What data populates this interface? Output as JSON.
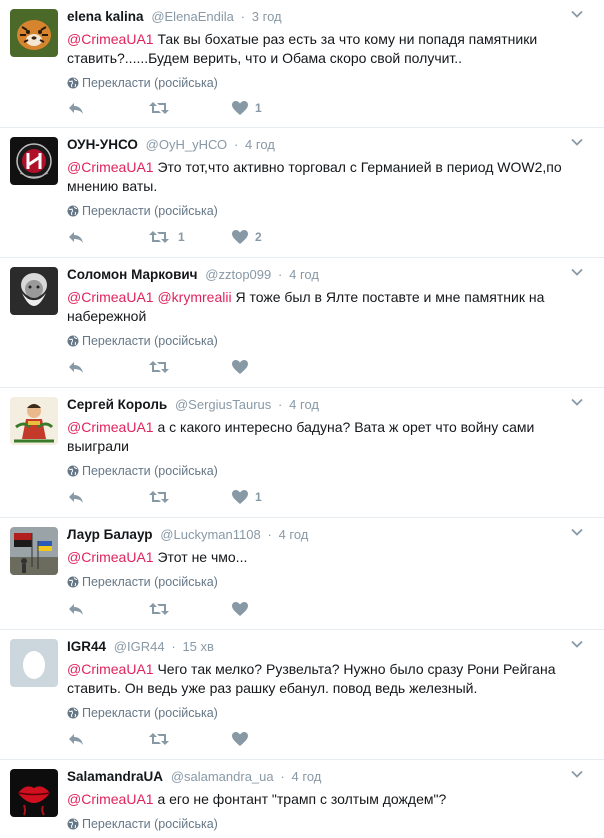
{
  "tweets": [
    {
      "name": "elena kalina",
      "handle": "@ElenaEndila",
      "time": "3 год",
      "mention": "@CrimeaUA1",
      "text": " Так вы бохатые раз есть за что кому ни попадя памятники ставить?......Будем верить, что и Обама скоро свой получит..",
      "translate": "Перекласти (російська)",
      "retweets": "",
      "likes": "1",
      "avatar": "tiger"
    },
    {
      "name": "ОУН-УНСО",
      "handle": "@ОуН_уНСО",
      "time": "4 год",
      "mention": "@CrimeaUA1",
      "text": " Это тот,что активно торговал с Германией  в период WOW2,по мнению ваты.",
      "translate": "Перекласти (російська)",
      "retweets": "1",
      "likes": "2",
      "avatar": "emblem"
    },
    {
      "name": "Соломон Маркович",
      "handle": "@zztop099",
      "time": "4 год",
      "mention": "@CrimeaUA1",
      "mention2": "@krymrealii",
      "text": " Я тоже был в Ялте поставте и мне памятник на набережной",
      "translate": "Перекласти (російська)",
      "retweets": "",
      "likes": "",
      "avatar": "bearded-man"
    },
    {
      "name": "Сергей Король",
      "handle": "@SergiusTaurus",
      "time": "4 год",
      "mention": "@CrimeaUA1",
      "text": " а с какого интересно бадуна? Вата ж орет что войну сами выиграли",
      "translate": "Перекласти (російська)",
      "retweets": "",
      "likes": "1",
      "avatar": "cossack"
    },
    {
      "name": "Лаур Балаур",
      "handle": "@Luckyman1108",
      "time": "4 год",
      "mention": "@CrimeaUA1",
      "text": " Этот не чмо...",
      "translate": "Перекласти (російська)",
      "retweets": "",
      "likes": "",
      "avatar": "flags"
    },
    {
      "name": "IGR44",
      "handle": "@IGR44",
      "time": "15 хв",
      "mention": "@CrimeaUA1",
      "text": " Чего так мелко? Рузвельта? Нужно было сразу Рони Рейгана ставить. Он ведь уже раз рашку ебанул. повод ведь железный.",
      "translate": "Перекласти (російська)",
      "retweets": "",
      "likes": "",
      "avatar": "egg"
    },
    {
      "name": "SalamandraUA",
      "handle": "@salamandra_ua",
      "time": "4 год",
      "mention": "@CrimeaUA1",
      "text": " а его не фонтант \"трамп с золтым дождем\"?",
      "translate": "Перекласти (російська)",
      "retweets": "",
      "likes": "",
      "avatar": "lips"
    }
  ],
  "colors": {
    "mention": "#e0245e",
    "meta": "#8899a6",
    "divider": "#e6ecf0"
  }
}
